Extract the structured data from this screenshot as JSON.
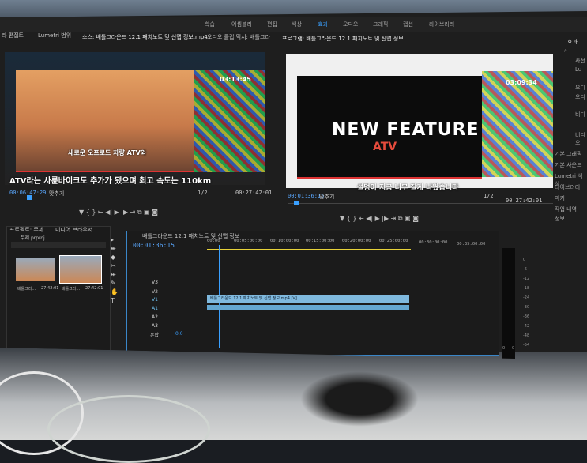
{
  "workspaces": [
    "학습",
    "어셈블리",
    "편집",
    "색상",
    "효과",
    "오디오",
    "그래픽",
    "캡션",
    "라이브러리"
  ],
  "source_panel": {
    "tab1": "소스: 배틀그라운드 12.1 패치노트 및 신맵 정보.mp4",
    "tab2": "오디오 클립 믹서: 배틀그라",
    "left_tabs": [
      "라 편집트",
      "Lumetri 범위"
    ],
    "timecode": "00:06:47:29",
    "fit": "맞추기",
    "page": "1/2",
    "duration": "00:27:42:01",
    "subtitle": "ATV라는 사륜바이크도 추가가 됐으며 최고 속도는 110km",
    "overlay_text": "새로운 오프로드 차량 ATV와",
    "stream_timer": "03:13:45"
  },
  "program_panel": {
    "tab": "프로그램: 배틀그라운드 12.1 패치노트 및 신맵 정보",
    "timecode": "00:01:36:15",
    "fit": "맞추기",
    "page": "1/2",
    "duration": "00:27:42:01",
    "headline": "NEW FEATURE",
    "subhead": "ATV",
    "subtitle": "설명이 지금 너무 잘게 나왔습니다",
    "stream_timer": "03:09:34"
  },
  "project_panel": {
    "tab1": "프로젝트: 무제",
    "tab2": "미디어 브라우저",
    "project_name": "무제.prproj",
    "items": [
      {
        "name": "배틀그라...",
        "dur": "27:42:01"
      },
      {
        "name": "배틀그라...",
        "dur": "27:42:01"
      }
    ]
  },
  "timeline": {
    "tab": "배틀그라운드 12.1 패치노트 및 신맵 정보",
    "timecode": "00:01:36:15",
    "ruler": [
      "00:00",
      "00:05:00:00",
      "00:10:00:00",
      "00:15:00:00",
      "00:20:00:00",
      "00:25:00:00",
      "00:30:00:00",
      "00:35:00:00"
    ],
    "tracks": [
      "V3",
      "V2",
      "V1",
      "A1",
      "A2",
      "A3",
      "혼합"
    ],
    "mix_value": "0.0",
    "clip_label": "배틀그라운드 12.1 패치노트 및 신맵 정보.mp4 [V]"
  },
  "effects_panel": {
    "title": "효과",
    "search": "",
    "items": [
      "사전",
      "Lu",
      "오디",
      "오디",
      "비디",
      "비디오"
    ],
    "list": [
      "기본 그래픽",
      "기본 사운드",
      "Lumetri 색상",
      "라이브러리",
      "마커",
      "작업 내역",
      "정보"
    ]
  },
  "meter_ticks": [
    "0",
    "-6",
    "-12",
    "-18",
    "-24",
    "-30",
    "-36",
    "-42",
    "-48",
    "-54"
  ],
  "meter_bottom": [
    "0",
    "0"
  ]
}
